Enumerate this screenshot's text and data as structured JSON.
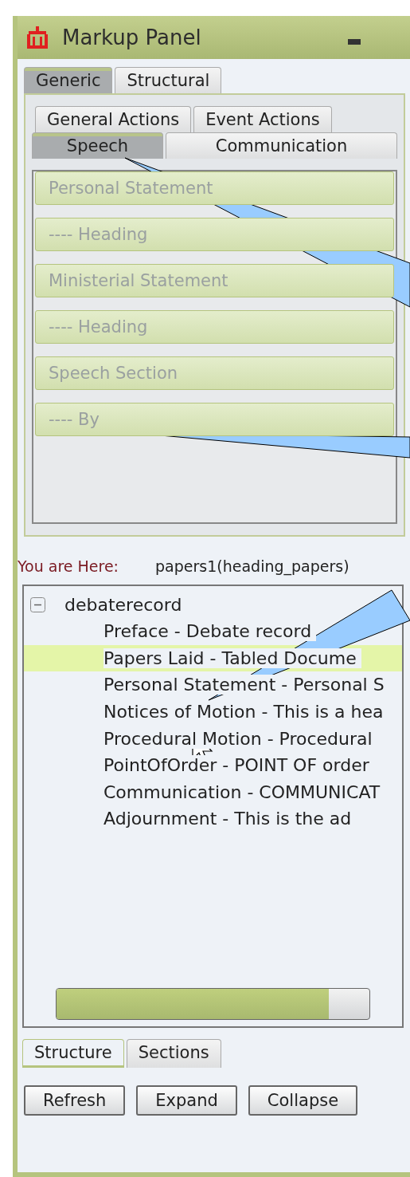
{
  "window": {
    "title": "Markup Panel"
  },
  "tabs": [
    {
      "label": "Generic",
      "selected": true
    },
    {
      "label": "Structural",
      "selected": false
    }
  ],
  "action_tabs": [
    {
      "label": "General Actions",
      "selected": false
    },
    {
      "label": "Event Actions",
      "selected": false
    }
  ],
  "element_tabs": [
    {
      "label": "Speech",
      "selected": true
    },
    {
      "label": "Communication",
      "selected": false
    }
  ],
  "element_buttons": [
    {
      "label": "Personal Statement",
      "disabled": true
    },
    {
      "label": "---- Heading",
      "disabled": true
    },
    {
      "label": "Ministerial Statement",
      "disabled": true
    },
    {
      "label": "---- Heading",
      "disabled": true
    },
    {
      "label": "Speech Section",
      "disabled": true
    },
    {
      "label": "---- By",
      "disabled": true
    }
  ],
  "location": {
    "label": "You are Here:",
    "value": "papers1(heading_papers)"
  },
  "tree": {
    "label": "debaterecord",
    "expanded": true,
    "children": [
      {
        "label": "Preface - Debate record",
        "selected": false
      },
      {
        "label": "Papers Laid - Tabled Docume",
        "selected": true
      },
      {
        "label": "Personal Statement - Personal S",
        "selected": false
      },
      {
        "label": "Notices of Motion - This is a hea",
        "selected": false
      },
      {
        "label": "Procedural Motion - Procedural",
        "selected": false
      },
      {
        "label": "PointOfOrder - POINT OF order",
        "selected": false
      },
      {
        "label": "Communication - COMMUNICAT",
        "selected": false
      },
      {
        "label": "Adjournment - This is the ad",
        "selected": false
      }
    ]
  },
  "bottom_tabs": [
    {
      "label": "Structure",
      "selected": true
    },
    {
      "label": "Sections",
      "selected": false
    }
  ],
  "buttons": [
    "Refresh",
    "Expand",
    "Collapse"
  ]
}
